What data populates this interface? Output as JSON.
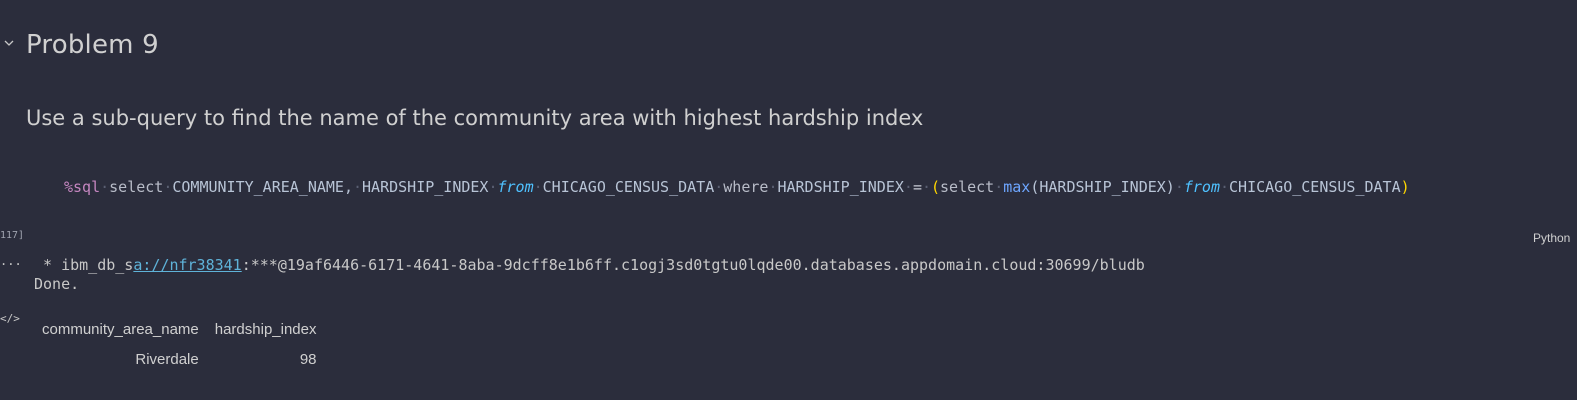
{
  "heading": "Problem 9",
  "paragraph": "Use a sub-query to find the name of the community area with highest hardship index",
  "code": {
    "magic": "%sql",
    "t1": "select",
    "t2": "COMMUNITY_AREA_NAME,",
    "t3": "HARDSHIP_INDEX",
    "t4": "from",
    "t5": "CHICAGO_CENSUS_DATA",
    "t6": "where",
    "t7": "HARDSHIP_INDEX",
    "t8": "=",
    "t9": "(",
    "t10": "select",
    "t11": "max",
    "t12": "(HARDSHIP_INDEX)",
    "t13": "from",
    "t14": "CHICAGO_CENSUS_DATA",
    "t15": ")"
  },
  "execution_count": "117]",
  "language": "Python",
  "output": {
    "more_icon": "...",
    "line1_prefix": " * ibm_db_s",
    "line1_link": "a://nfr38341",
    "line1_suffix": ":***@19af6446-6171-4641-8aba-9dcff8e1b6ff.c1ogj3sd0tgtu0lqde00.databases.appdomain.cloud:30699/bludb",
    "line2": "Done.",
    "code_icon": "</>"
  },
  "table": {
    "headers": [
      "community_area_name",
      "hardship_index"
    ],
    "rows": [
      [
        "Riverdale",
        "98"
      ]
    ]
  }
}
